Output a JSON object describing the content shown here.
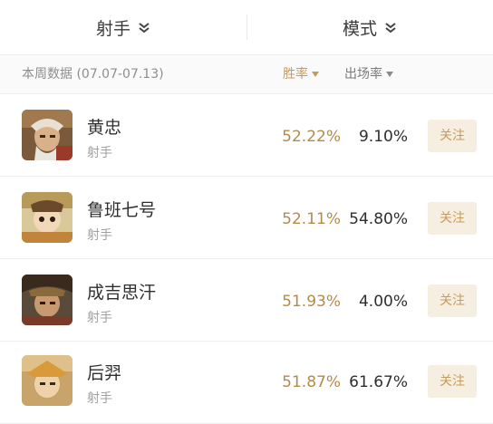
{
  "header": {
    "role_filter": "射手",
    "mode_filter": "模式"
  },
  "subheader": {
    "period": "本周数据 (07.07-07.13)",
    "sort_winrate": "胜率",
    "sort_playrate": "出场率"
  },
  "heroes": [
    {
      "name": "黄忠",
      "role": "射手",
      "win_rate": "52.22%",
      "play_rate": "9.10%",
      "follow": "关注"
    },
    {
      "name": "鲁班七号",
      "role": "射手",
      "win_rate": "52.11%",
      "play_rate": "54.80%",
      "follow": "关注"
    },
    {
      "name": "成吉思汗",
      "role": "射手",
      "win_rate": "51.93%",
      "play_rate": "4.00%",
      "follow": "关注"
    },
    {
      "name": "后羿",
      "role": "射手",
      "win_rate": "51.87%",
      "play_rate": "61.67%",
      "follow": "关注"
    }
  ],
  "colors": {
    "accent": "#c79a59",
    "follow_bg": "#f6eee1"
  }
}
